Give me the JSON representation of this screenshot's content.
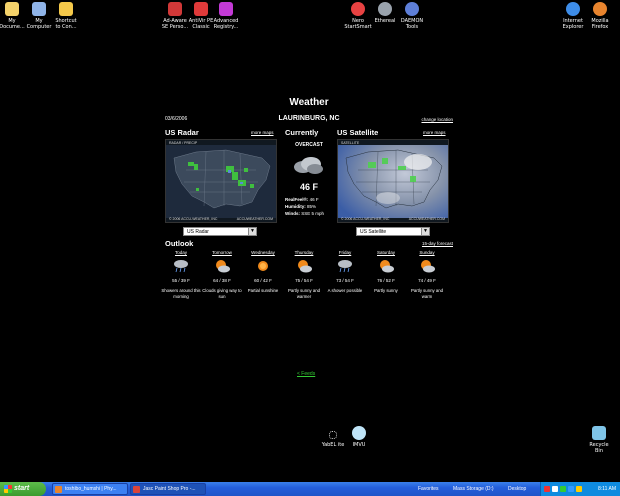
{
  "desktop_icons": [
    {
      "id": "my-documents",
      "label": "My\nDocume...",
      "icon": "folder-documents-icon",
      "color": "#f5d36b"
    },
    {
      "id": "my-computer",
      "label": "My\nComputer",
      "icon": "computer-icon",
      "color": "#8fb4e8"
    },
    {
      "id": "shortcut",
      "label": "Shortcut\nto Con...",
      "icon": "folder-icon",
      "color": "#f5c94a"
    },
    {
      "id": "adaware",
      "label": "Ad-Aware\nSE Perso...",
      "icon": "adaware-icon",
      "color": "#d13838"
    },
    {
      "id": "antivir",
      "label": "AntiVir PE\nClassic",
      "icon": "antivir-icon",
      "color": "#e03a3a"
    },
    {
      "id": "advanced-registry",
      "label": "Advanced\nRegistry...",
      "icon": "registry-icon",
      "color": "#c33ad6"
    },
    {
      "id": "nero",
      "label": "Nero\nStartSmart",
      "icon": "nero-icon",
      "color": "#e84242"
    },
    {
      "id": "ethereal",
      "label": "Ethereal",
      "icon": "ethereal-icon",
      "color": "#9aa3ad"
    },
    {
      "id": "daemon",
      "label": "DAEMON\nTools",
      "icon": "daemon-icon",
      "color": "#5e7fd8"
    },
    {
      "id": "internet-explorer",
      "label": "Internet\nExplorer",
      "icon": "internet-explorer-icon",
      "color": "#3e8de8"
    },
    {
      "id": "firefox",
      "label": "Mozilla\nFirefox",
      "icon": "firefox-icon",
      "color": "#e8842e"
    },
    {
      "id": "yahoo-lite",
      "label": "YabEL ite",
      "icon": "yahoo-icon",
      "color": "#cfcfcf"
    },
    {
      "id": "imvu",
      "label": "IMVU",
      "icon": "imvu-icon",
      "color": "#bfe4f7"
    },
    {
      "id": "recycle-bin",
      "label": "Recycle\nBin",
      "icon": "recycle-bin-icon",
      "color": "#7fc4e8"
    }
  ],
  "weather": {
    "title": "Weather",
    "date": "03/6/2006",
    "city": "LAURINBURG, NC",
    "change_location": "change location",
    "radar": {
      "heading": "US Radar",
      "more_maps": "more maps",
      "select_value": "US Radar",
      "caption_top": "RADAR / PRECIP",
      "caption_bottom": "© 2006 ACCU-WEATHER, INC",
      "caption_right": "ACCUWEATHER.COM"
    },
    "current": {
      "heading": "Currently",
      "condition": "OVERCAST",
      "icon": "cloud-icon",
      "temperature": "46 F",
      "realfeel_label": "RealFeel®:",
      "realfeel_value": "46 F",
      "humidity_label": "Humidity:",
      "humidity_value": "85%",
      "winds_label": "Winds:",
      "winds_value": "SSE 5 mph"
    },
    "satellite": {
      "heading": "US Satellite",
      "more_maps": "more maps",
      "select_value": "US Satellite",
      "caption_top": "SATELLITE",
      "caption_bottom": "© 2006 ACCU-WEATHER, INC",
      "caption_right": "ACCUWEATHER.COM"
    },
    "outlook": {
      "heading": "Outlook",
      "forecast_link": "15-day forecast",
      "days": [
        {
          "name": "Today",
          "temps": "55 / 39 F",
          "desc": "Showers around this morning",
          "icon": "showers-icon"
        },
        {
          "name": "Tomorrow",
          "temps": "64 / 38 F",
          "desc": "Clouds giving way to sun",
          "icon": "sun-cloud-icon"
        },
        {
          "name": "Wednesday",
          "temps": "60 / 42 F",
          "desc": "Partial sunshine",
          "icon": "sun-icon"
        },
        {
          "name": "Thursday",
          "temps": "75 / 54 F",
          "desc": "Partly sunny and warmer",
          "icon": "sun-cloud-icon"
        },
        {
          "name": "Friday",
          "temps": "73 / 54 F",
          "desc": "A shower possible",
          "icon": "showers-icon"
        },
        {
          "name": "Saturday",
          "temps": "76 / 52 F",
          "desc": "Partly sunny",
          "icon": "sun-cloud-icon"
        },
        {
          "name": "Sunday",
          "temps": "74 / 49 F",
          "desc": "Partly sunny and warm",
          "icon": "sun-cloud-icon"
        }
      ]
    }
  },
  "feeds_link": "< Feeds",
  "taskbar": {
    "start_label": "start",
    "tasks": [
      {
        "label": "toshibo_humshi | Phy...",
        "icon": "firefox-icon",
        "color": "#e8842e",
        "active": false
      },
      {
        "label": "Jasc Paint Shop Pro -...",
        "icon": "paintshop-icon",
        "color": "#d9443a",
        "active": true
      }
    ],
    "favorites_label": "Favorites",
    "mass_storage_label": "Mass Storage (D:)",
    "desktop_label": "Desktop",
    "clock": "8:11 AM"
  },
  "colors": {
    "taskbar_blue": "#245edb",
    "start_green": "#3a9b2e",
    "tray_blue": "#0f8bdf",
    "feeds_green": "#33cc33"
  }
}
